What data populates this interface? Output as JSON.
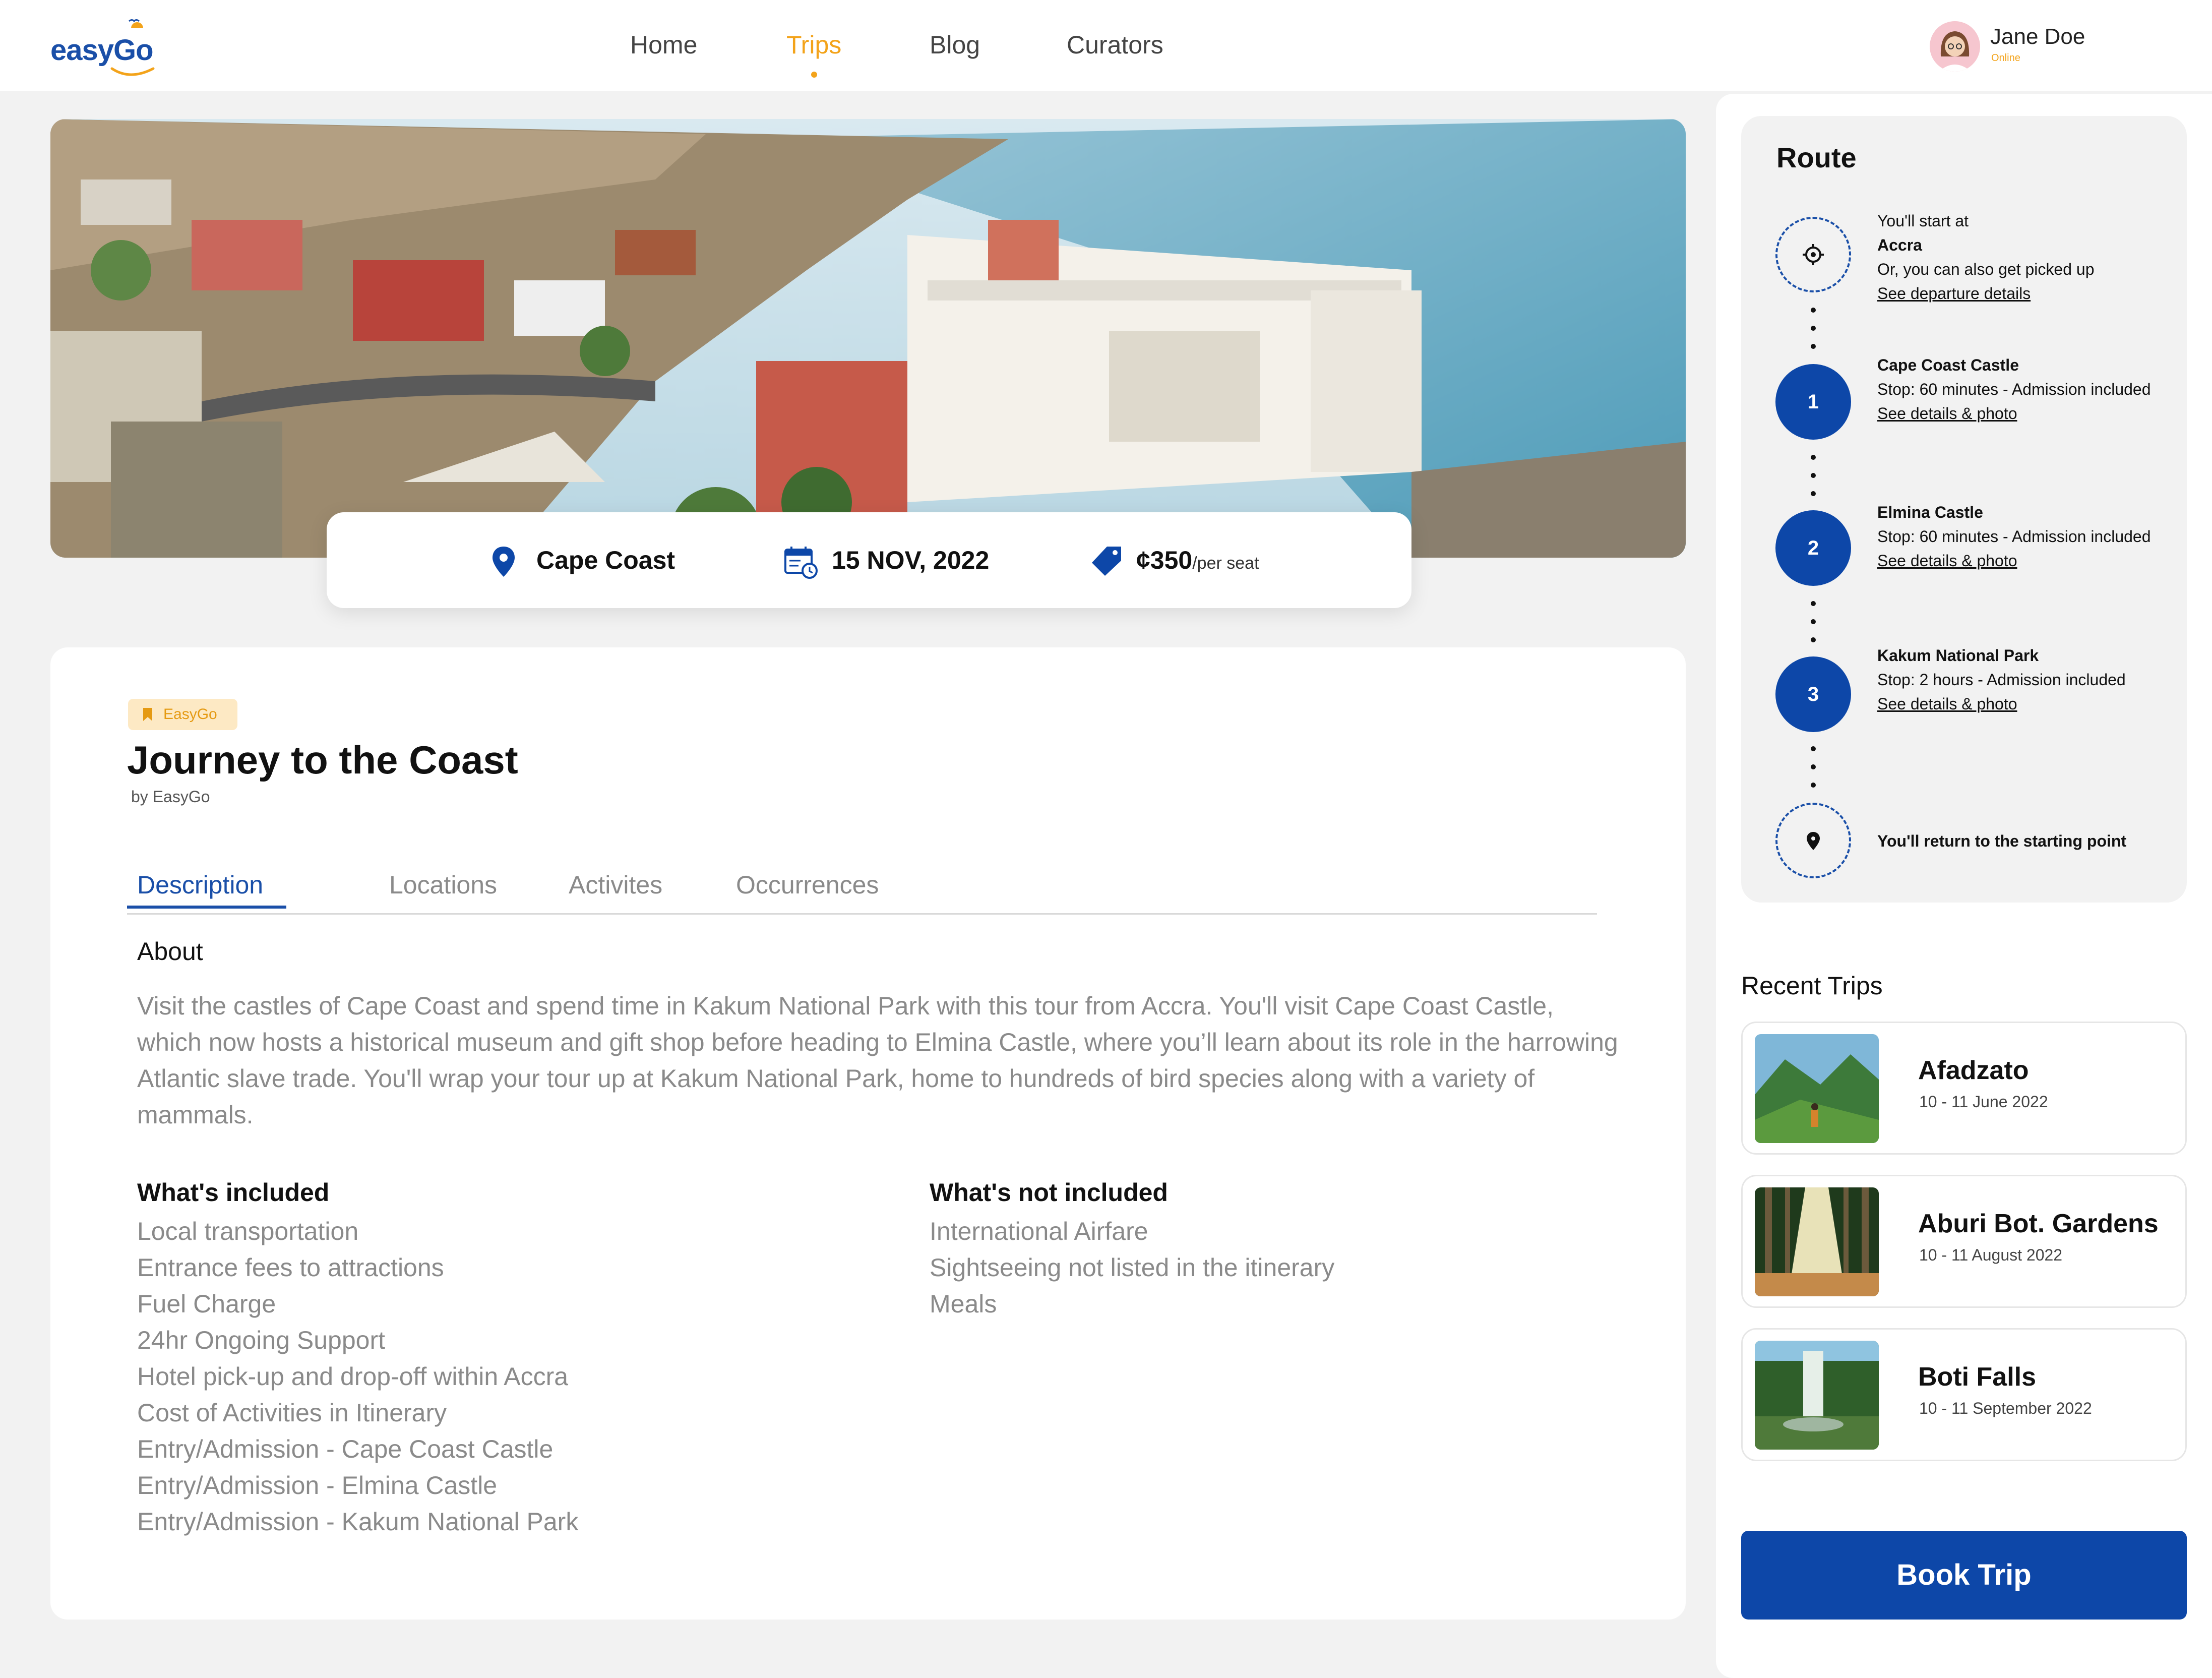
{
  "header": {
    "logo_text": "easyGo",
    "nav": [
      {
        "label": "Home",
        "active": false
      },
      {
        "label": "Trips",
        "active": true
      },
      {
        "label": "Blog",
        "active": false
      },
      {
        "label": "Curators",
        "active": false
      }
    ],
    "user": {
      "name": "Jane Doe",
      "status": "Online"
    }
  },
  "hero": {
    "location": "Cape Coast",
    "date": "15 NOV, 2022",
    "price": "¢350",
    "price_unit": "/per seat"
  },
  "trip": {
    "tag": "EasyGo",
    "title": "Journey to the Coast",
    "by": "by EasyGo",
    "tabs": [
      {
        "label": "Description",
        "active": true
      },
      {
        "label": "Locations",
        "active": false
      },
      {
        "label": "Activites",
        "active": false
      },
      {
        "label": "Occurrences",
        "active": false
      }
    ],
    "about_heading": "About",
    "about_text": "Visit the castles of Cape Coast and spend time in Kakum National Park with this tour from Accra. You'll visit Cape Coast Castle, which now hosts a historical museum and gift shop before heading to Elmina Castle, where you’ll learn about its role in the harrowing Atlantic slave trade. You'll wrap your tour up at Kakum National Park, home to hundreds of bird species along with a variety of mammals.",
    "included_heading": "What's included",
    "included": [
      "Local transportation",
      "Entrance fees to attractions",
      "Fuel Charge",
      "24hr Ongoing Support",
      "Hotel pick-up and drop-off within Accra",
      "Cost of Activities in Itinerary",
      "Entry/Admission - Cape Coast Castle",
      "Entry/Admission - Elmina Castle",
      "Entry/Admission - Kakum National Park"
    ],
    "not_included_heading": "What's not included",
    "not_included": [
      "International Airfare",
      "Sightseeing not listed in the itinerary",
      "Meals"
    ]
  },
  "route": {
    "title": "Route",
    "start": {
      "line1": "You'll start at",
      "place": "Accra",
      "line2": "Or, you can also get picked up",
      "link": "See departure details"
    },
    "stops": [
      {
        "num": "1",
        "name": "Cape Coast Castle",
        "info": "Stop: 60 minutes - Admission included",
        "link": "See details & photo"
      },
      {
        "num": "2",
        "name": "Elmina Castle",
        "info": "Stop: 60 minutes - Admission included",
        "link": "See details & photo"
      },
      {
        "num": "3",
        "name": "Kakum National Park",
        "info": "Stop: 2 hours - Admission included",
        "link": "See details & photo"
      }
    ],
    "end": "You'll return to the starting point"
  },
  "recent": {
    "title": "Recent Trips",
    "trips": [
      {
        "name": "Afadzato",
        "dates": "10 - 11 June 2022"
      },
      {
        "name": "Aburi Bot. Gardens",
        "dates": "10 - 11 August 2022"
      },
      {
        "name": "Boti Falls",
        "dates": "10 - 11 September 2022"
      }
    ]
  },
  "book_button": "Book Trip",
  "colors": {
    "primary": "#0d47a8",
    "accent": "#f3a31a",
    "muted_text": "#8a8a8a"
  }
}
